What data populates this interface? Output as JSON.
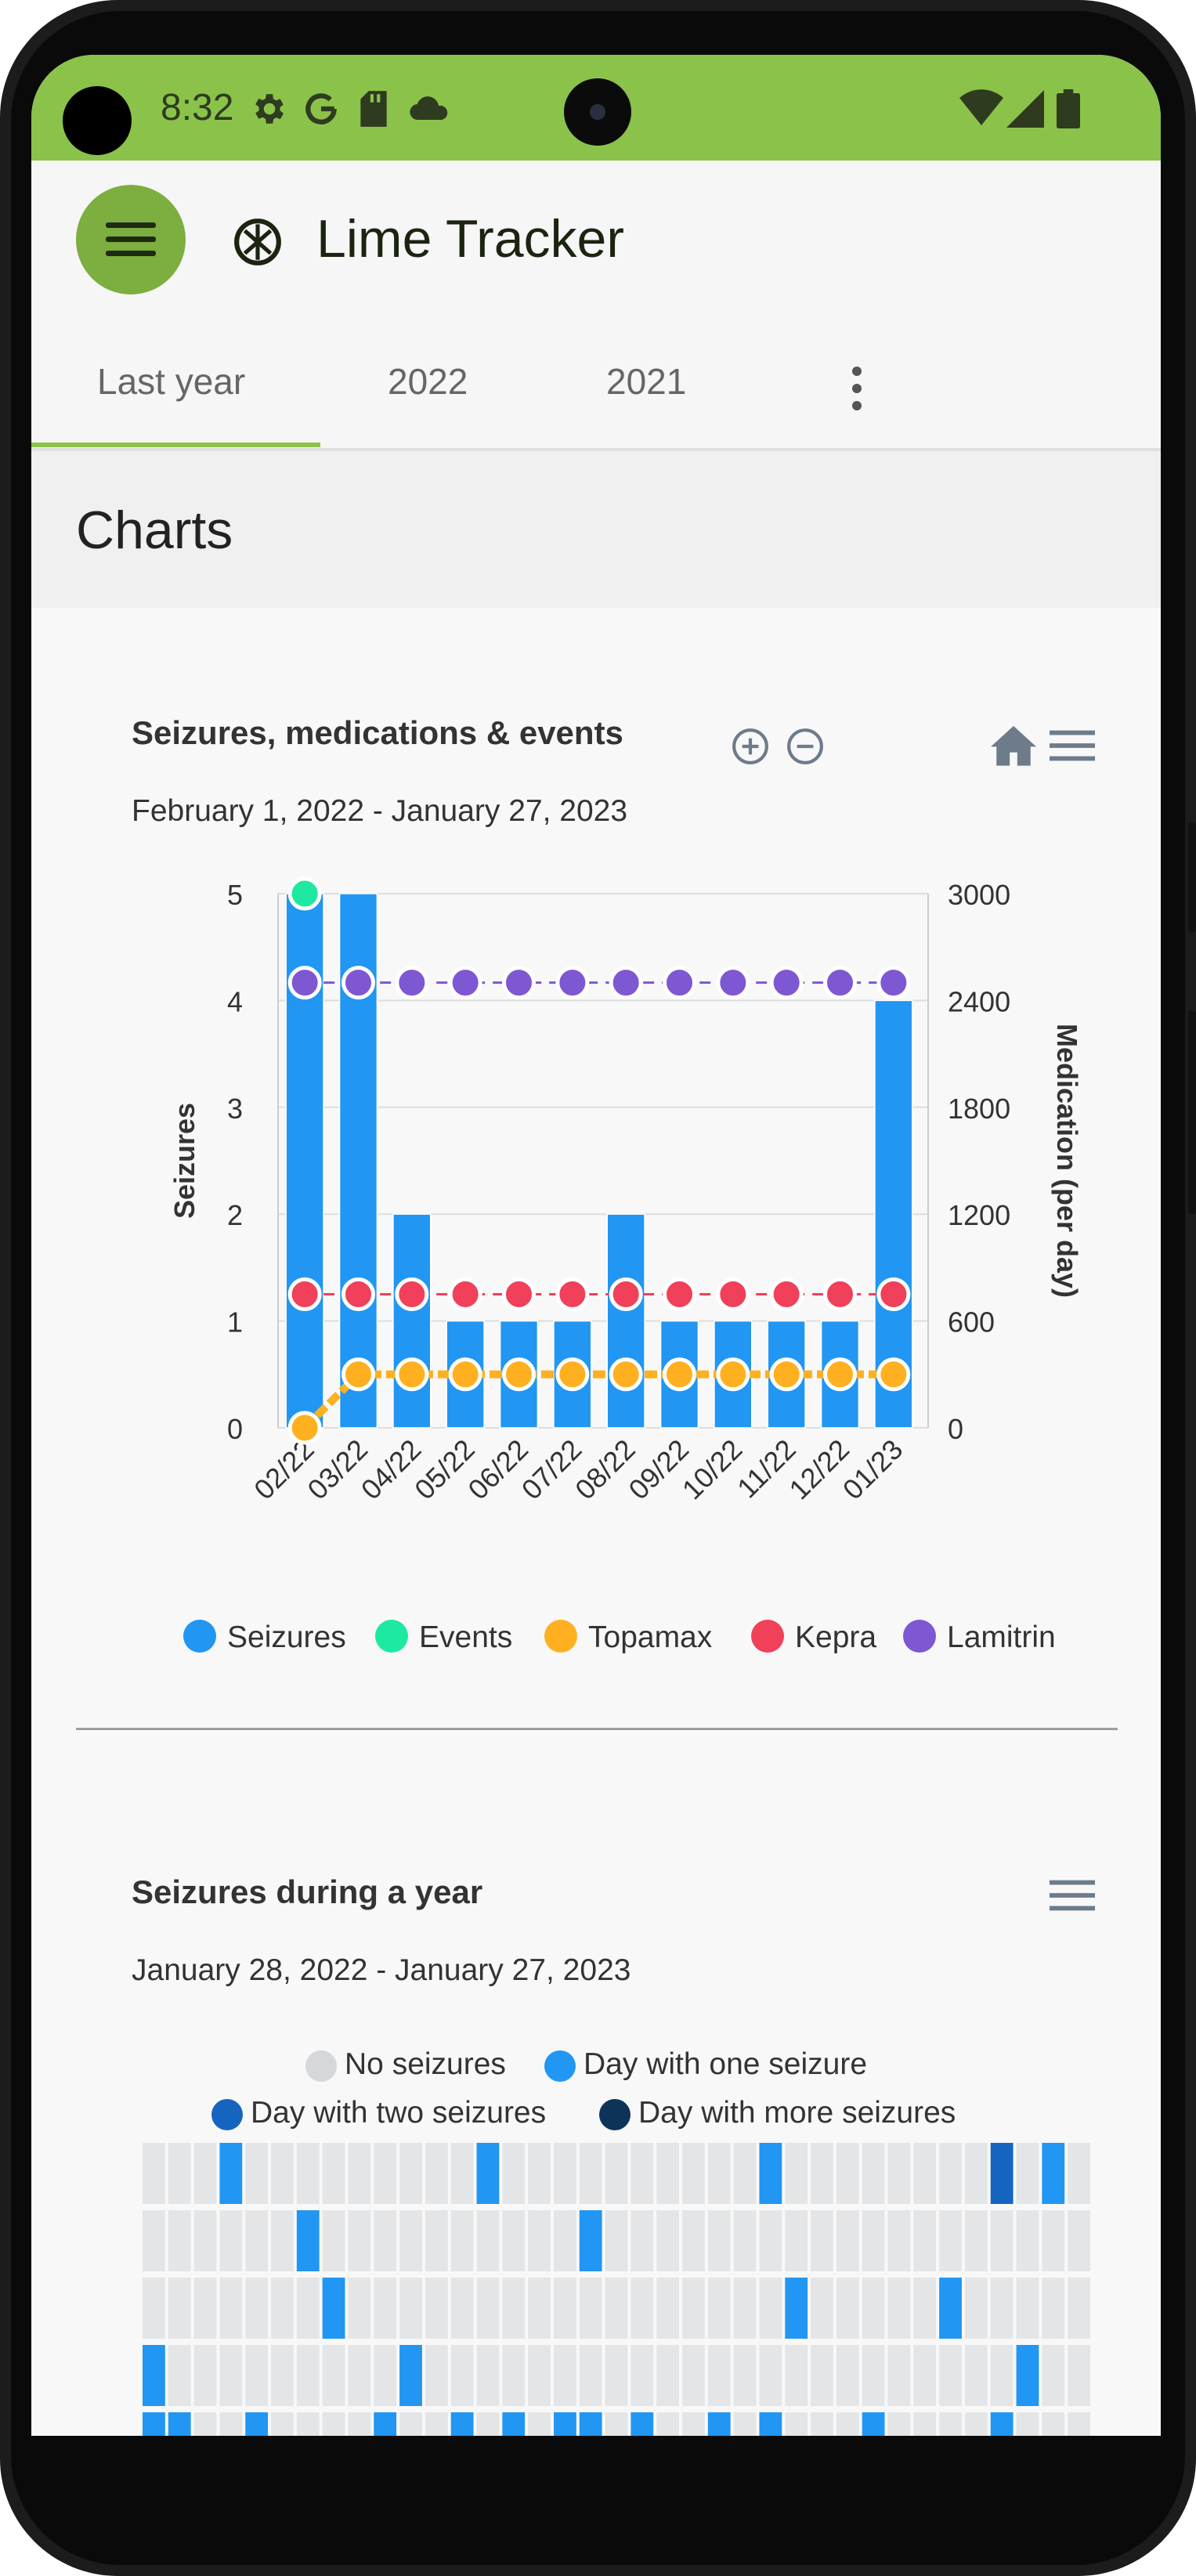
{
  "status_bar": {
    "time": "8:32",
    "icons": [
      "gear-icon",
      "google-icon",
      "sd-card-icon",
      "cloud-icon",
      "wifi-icon",
      "cell-signal-icon",
      "battery-icon"
    ]
  },
  "app_bar": {
    "title": "Lime Tracker",
    "menu_icon": "hamburger-icon",
    "logo_icon": "lime-logo-icon"
  },
  "tabs": [
    {
      "label": "Last year",
      "selected": true
    },
    {
      "label": "2022"
    },
    {
      "label": "2021"
    }
  ],
  "page": {
    "title": "Charts"
  },
  "colors": {
    "brand": "#8bc34a",
    "seizures": "#2196f3",
    "events": "#1de9a0",
    "topamax": "#ffb020",
    "kepra": "#f0405a",
    "lamitrin": "#7e57d2",
    "no_seizures": "#d5d7da",
    "one_seizure": "#2196f3",
    "two_seizures": "#1565c0",
    "more_seizures": "#0d3358"
  },
  "chart1": {
    "title": "Seizures, medications & events",
    "subtitle": "February 1, 2022 - January 27, 2023",
    "ylabel_left": "Seizures",
    "ylabel_right": "Medication (per day)",
    "legend": [
      "Seizures",
      "Events",
      "Topamax",
      "Kepra",
      "Lamitrin"
    ],
    "left_ticks": [
      "0",
      "1",
      "2",
      "3",
      "4",
      "5"
    ],
    "right_ticks": [
      "0",
      "600",
      "1200",
      "1800",
      "2400",
      "3000"
    ]
  },
  "chart2": {
    "title": "Seizures during a year",
    "subtitle": "January 28, 2022 - January 27, 2023",
    "legend": [
      "No seizures",
      "Day with one seizure",
      "Day with two seizures",
      "Day with more seizures"
    ]
  },
  "chart_data": [
    {
      "type": "bar",
      "title": "Seizures, medications & events",
      "categories": [
        "02/22",
        "03/22",
        "04/22",
        "05/22",
        "06/22",
        "07/22",
        "08/22",
        "09/22",
        "10/22",
        "11/22",
        "12/22",
        "01/23"
      ],
      "ylim_left": [
        0,
        5
      ],
      "ylim_right": [
        0,
        3000
      ],
      "series": [
        {
          "name": "Seizures",
          "kind": "bar",
          "axis": "left",
          "values": [
            5,
            5,
            2,
            1,
            1,
            1,
            2,
            1,
            1,
            1,
            1,
            4
          ]
        },
        {
          "name": "Events",
          "kind": "point",
          "axis": "left",
          "values": [
            5,
            null,
            null,
            null,
            null,
            null,
            null,
            null,
            null,
            null,
            null,
            null
          ]
        },
        {
          "name": "Topamax",
          "kind": "line",
          "axis": "right",
          "values": [
            0,
            300,
            300,
            300,
            300,
            300,
            300,
            300,
            300,
            300,
            300,
            300
          ]
        },
        {
          "name": "Kepra",
          "kind": "line",
          "axis": "right",
          "values": [
            750,
            750,
            750,
            750,
            750,
            750,
            750,
            750,
            750,
            750,
            750,
            750
          ]
        },
        {
          "name": "Lamitrin",
          "kind": "line",
          "axis": "right",
          "values": [
            2500,
            2500,
            2500,
            2500,
            2500,
            2500,
            2500,
            2500,
            2500,
            2500,
            2500,
            2500
          ]
        }
      ]
    },
    {
      "type": "heatmap",
      "title": "Seizures during a year",
      "columns": 37,
      "rows_visible": 5,
      "marked": [
        {
          "row": 0,
          "col": 3,
          "level": 1
        },
        {
          "row": 0,
          "col": 13,
          "level": 1
        },
        {
          "row": 0,
          "col": 24,
          "level": 1
        },
        {
          "row": 0,
          "col": 33,
          "level": 2
        },
        {
          "row": 0,
          "col": 35,
          "level": 1
        },
        {
          "row": 1,
          "col": 6,
          "level": 1
        },
        {
          "row": 1,
          "col": 17,
          "level": 1
        },
        {
          "row": 2,
          "col": 7,
          "level": 1
        },
        {
          "row": 2,
          "col": 25,
          "level": 1
        },
        {
          "row": 2,
          "col": 31,
          "level": 1
        },
        {
          "row": 3,
          "col": 0,
          "level": 1
        },
        {
          "row": 3,
          "col": 10,
          "level": 1
        },
        {
          "row": 3,
          "col": 34,
          "level": 1
        },
        {
          "row": 4,
          "col": 0,
          "level": 1
        },
        {
          "row": 4,
          "col": 1,
          "level": 1
        },
        {
          "row": 4,
          "col": 4,
          "level": 1
        },
        {
          "row": 4,
          "col": 9,
          "level": 1
        },
        {
          "row": 4,
          "col": 12,
          "level": 1
        },
        {
          "row": 4,
          "col": 14,
          "level": 1
        },
        {
          "row": 4,
          "col": 16,
          "level": 1
        },
        {
          "row": 4,
          "col": 17,
          "level": 1
        },
        {
          "row": 4,
          "col": 19,
          "level": 1
        },
        {
          "row": 4,
          "col": 22,
          "level": 1
        },
        {
          "row": 4,
          "col": 24,
          "level": 1
        },
        {
          "row": 4,
          "col": 28,
          "level": 1
        },
        {
          "row": 4,
          "col": 33,
          "level": 1
        }
      ]
    }
  ]
}
